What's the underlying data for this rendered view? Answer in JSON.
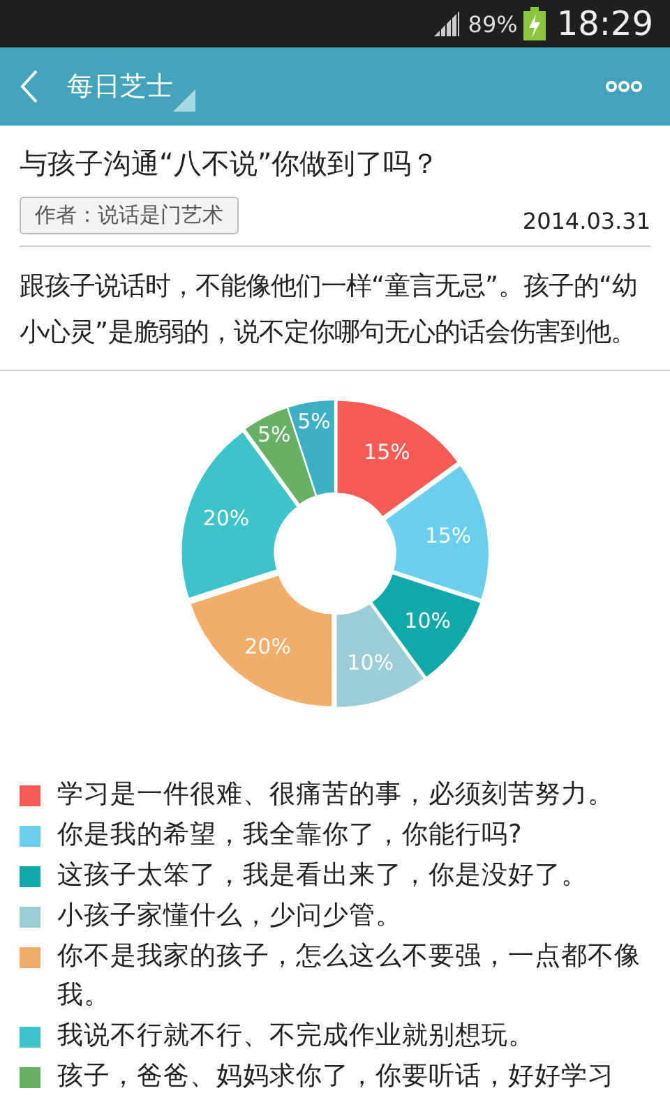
{
  "status_bar": {
    "battery": "89%",
    "time": "18:29"
  },
  "app_bar": {
    "title": "每日芝士"
  },
  "article": {
    "title": "与孩子沟通“八不说”你做到了吗？",
    "author": "作者：说话是门艺术",
    "date": "2014.03.31",
    "intro": "跟孩子说话时，不能像他们一样“童言无忌”。孩子的“幼小心灵”是脆弱的，说不定你哪句无心的话会伤害到他。"
  },
  "chart_data": {
    "type": "donut",
    "values": [
      15,
      15,
      10,
      10,
      20,
      20,
      5,
      5
    ],
    "value_labels": [
      "15%",
      "15%",
      "10%",
      "10%",
      "20%",
      "20%",
      "5%",
      "5%"
    ],
    "colors": [
      "#f55a54",
      "#6acfec",
      "#10a8a8",
      "#9ccdd7",
      "#f2ad6a",
      "#3dc4cb",
      "#68b065",
      "#3fb0c4"
    ]
  },
  "legend": [
    {
      "text": "学习是一件很难、很痛苦的事，必须刻苦努力。",
      "color": "#f55a54"
    },
    {
      "text": "你是我的希望，我全靠你了，你能行吗?",
      "color": "#6acfec"
    },
    {
      "text": "这孩子太笨了，我是看出来了，你是没好了。",
      "color": "#10a8a8"
    },
    {
      "text": "小孩子家懂什么，少问少管。",
      "color": "#9ccdd7"
    },
    {
      "text": "你不是我家的孩子，怎么这么不要强，一点都不像我。",
      "color": "#f2ad6a"
    },
    {
      "text": "我说不行就不行、不完成作业就别想玩。",
      "color": "#3dc4cb"
    },
    {
      "text": "孩子，爸爸、妈妈求你了，你要听话，好好学习",
      "color": "#68b065"
    }
  ]
}
